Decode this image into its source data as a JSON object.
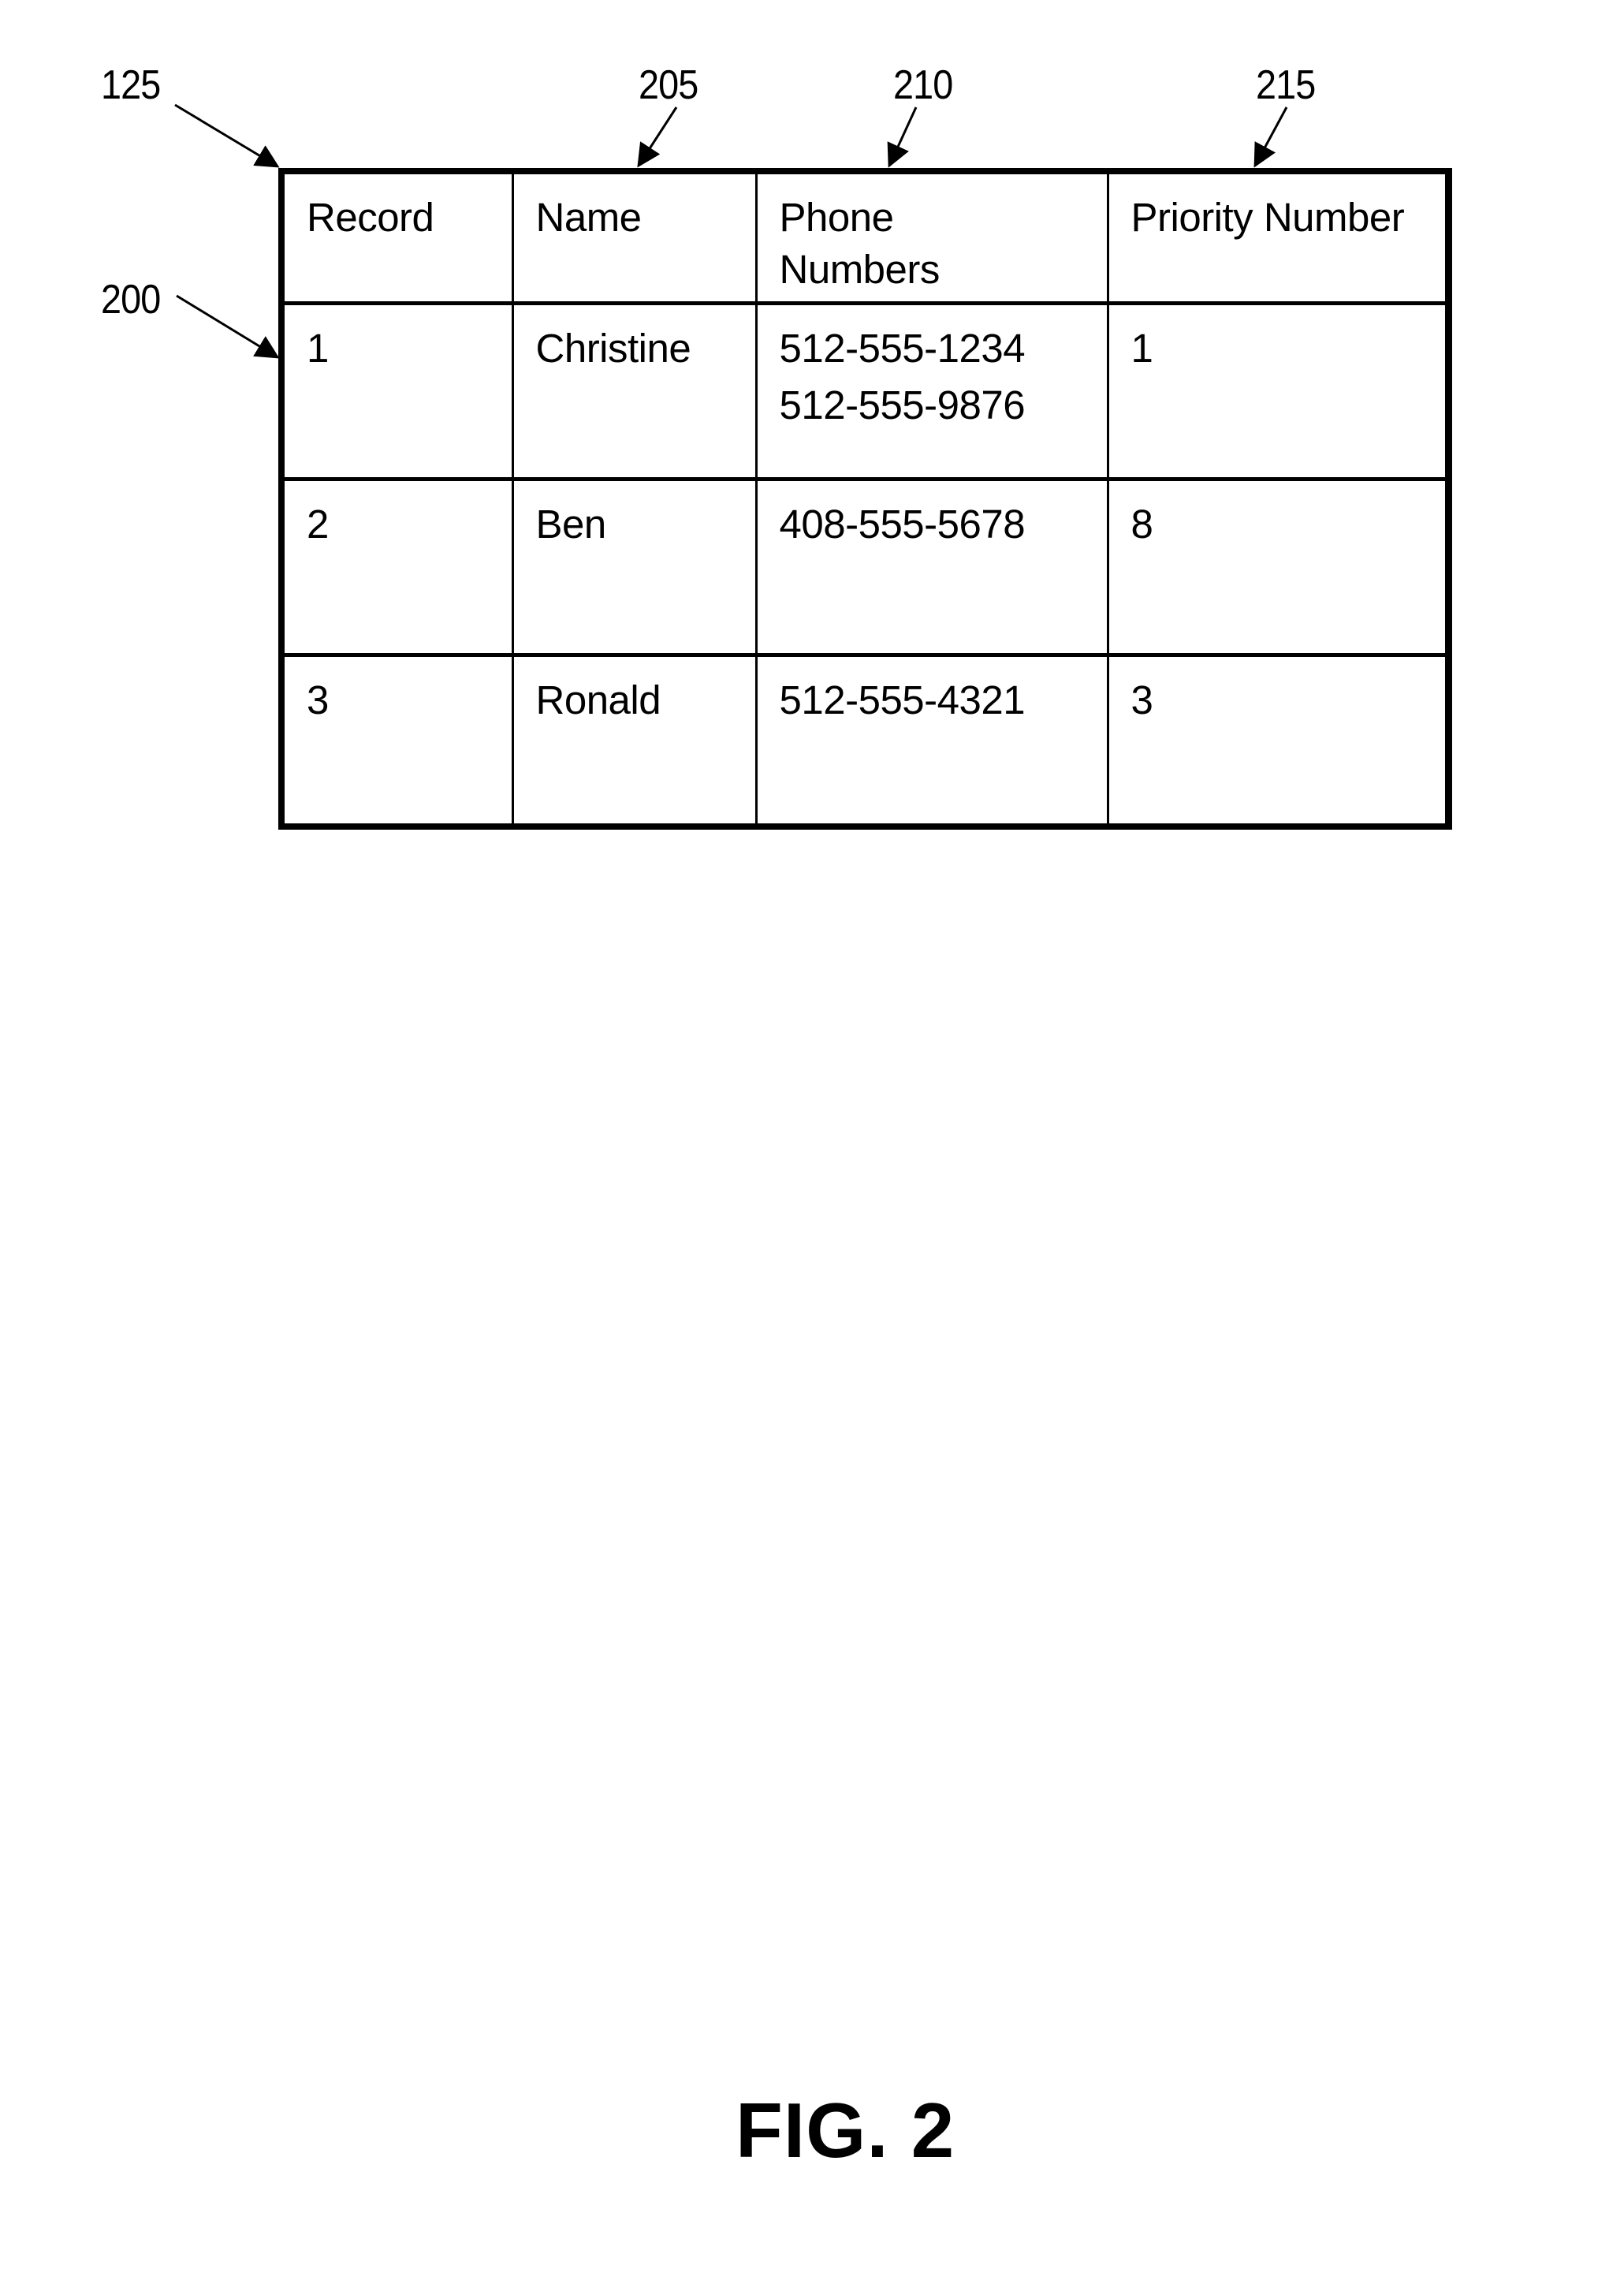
{
  "figure": {
    "label": "FIG. 2"
  },
  "reference_numerals": {
    "table": "125",
    "record_row": "200",
    "name_column": "205",
    "phone_column": "210",
    "priority_column": "215"
  },
  "table": {
    "headers": [
      "Record",
      "Name",
      "Phone\nNumbers",
      "Priority Number"
    ],
    "header_lines": {
      "record": "Record",
      "name": "Name",
      "phone_line1": "Phone",
      "phone_line2": "Numbers",
      "priority": "Priority Number"
    },
    "rows": [
      {
        "record": "1",
        "name": "Christine",
        "phones": [
          "512-555-1234",
          "512-555-9876"
        ],
        "priority": "1"
      },
      {
        "record": "2",
        "name": "Ben",
        "phones": [
          "408-555-5678"
        ],
        "priority": "8"
      },
      {
        "record": "3",
        "name": "Ronald",
        "phones": [
          "512-555-4321"
        ],
        "priority": "3"
      }
    ]
  }
}
